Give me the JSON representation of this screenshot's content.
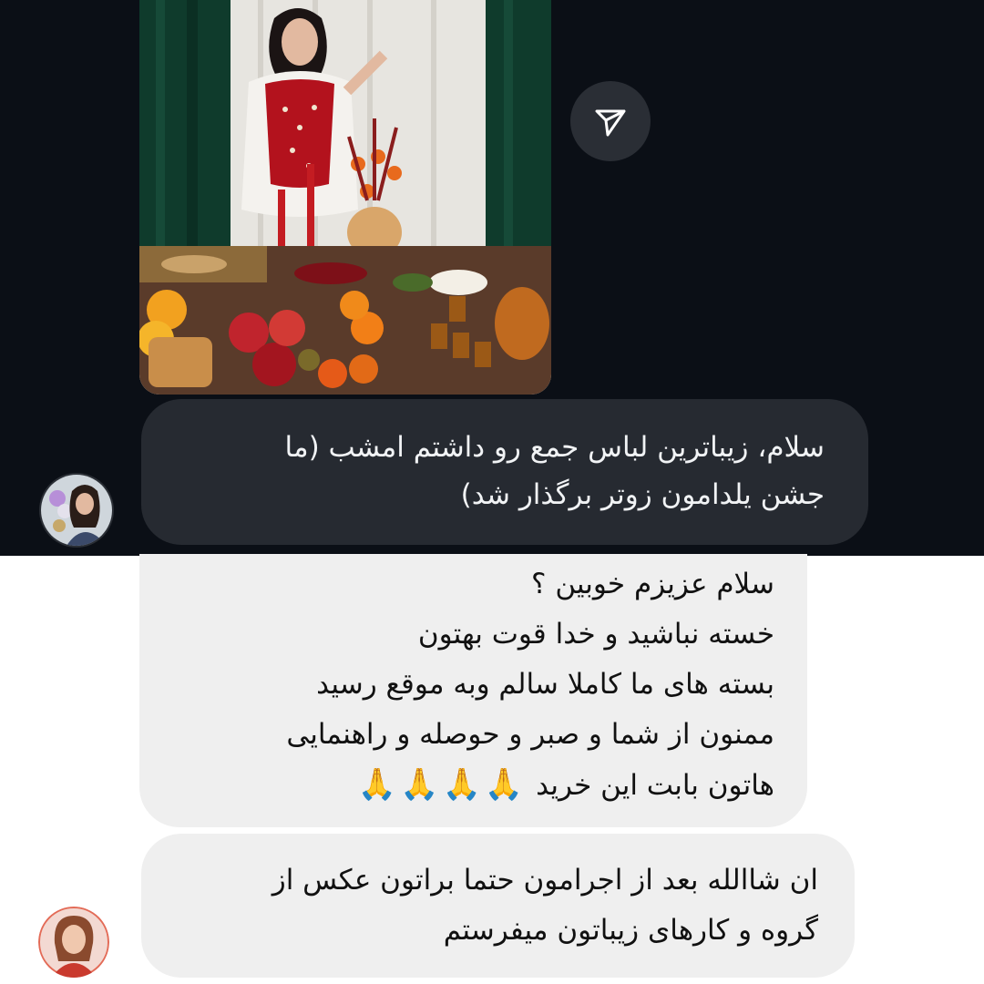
{
  "colors": {
    "dark_background": "#0b0f16",
    "dark_bubble": "#262a31",
    "light_bubble": "#efefef",
    "light_background": "#ffffff"
  },
  "icons": {
    "share": "paper-plane-icon"
  },
  "messages": [
    {
      "lines": [
        "سلام، زیباترین لباس جمع رو داشتم امشب (ما",
        "جشن یلدامون زوتر برگذار شد)"
      ]
    },
    {
      "lines": [
        "سلام عزیزم خوبین ؟",
        "خسته نباشید و خدا قوت بهتون",
        "بسته های ما کاملا سالم وبه موقع رسید",
        "ممنون از شما و صبر و حوصله و راهنمایی",
        "هاتون بابت این خرید"
      ],
      "emoji": "🙏🙏🙏🙏"
    },
    {
      "lines": [
        "ان شاالله بعد از اجرامون حتما براتون عکس از",
        "گروه و کارهای زیباتون میفرستم"
      ]
    }
  ]
}
